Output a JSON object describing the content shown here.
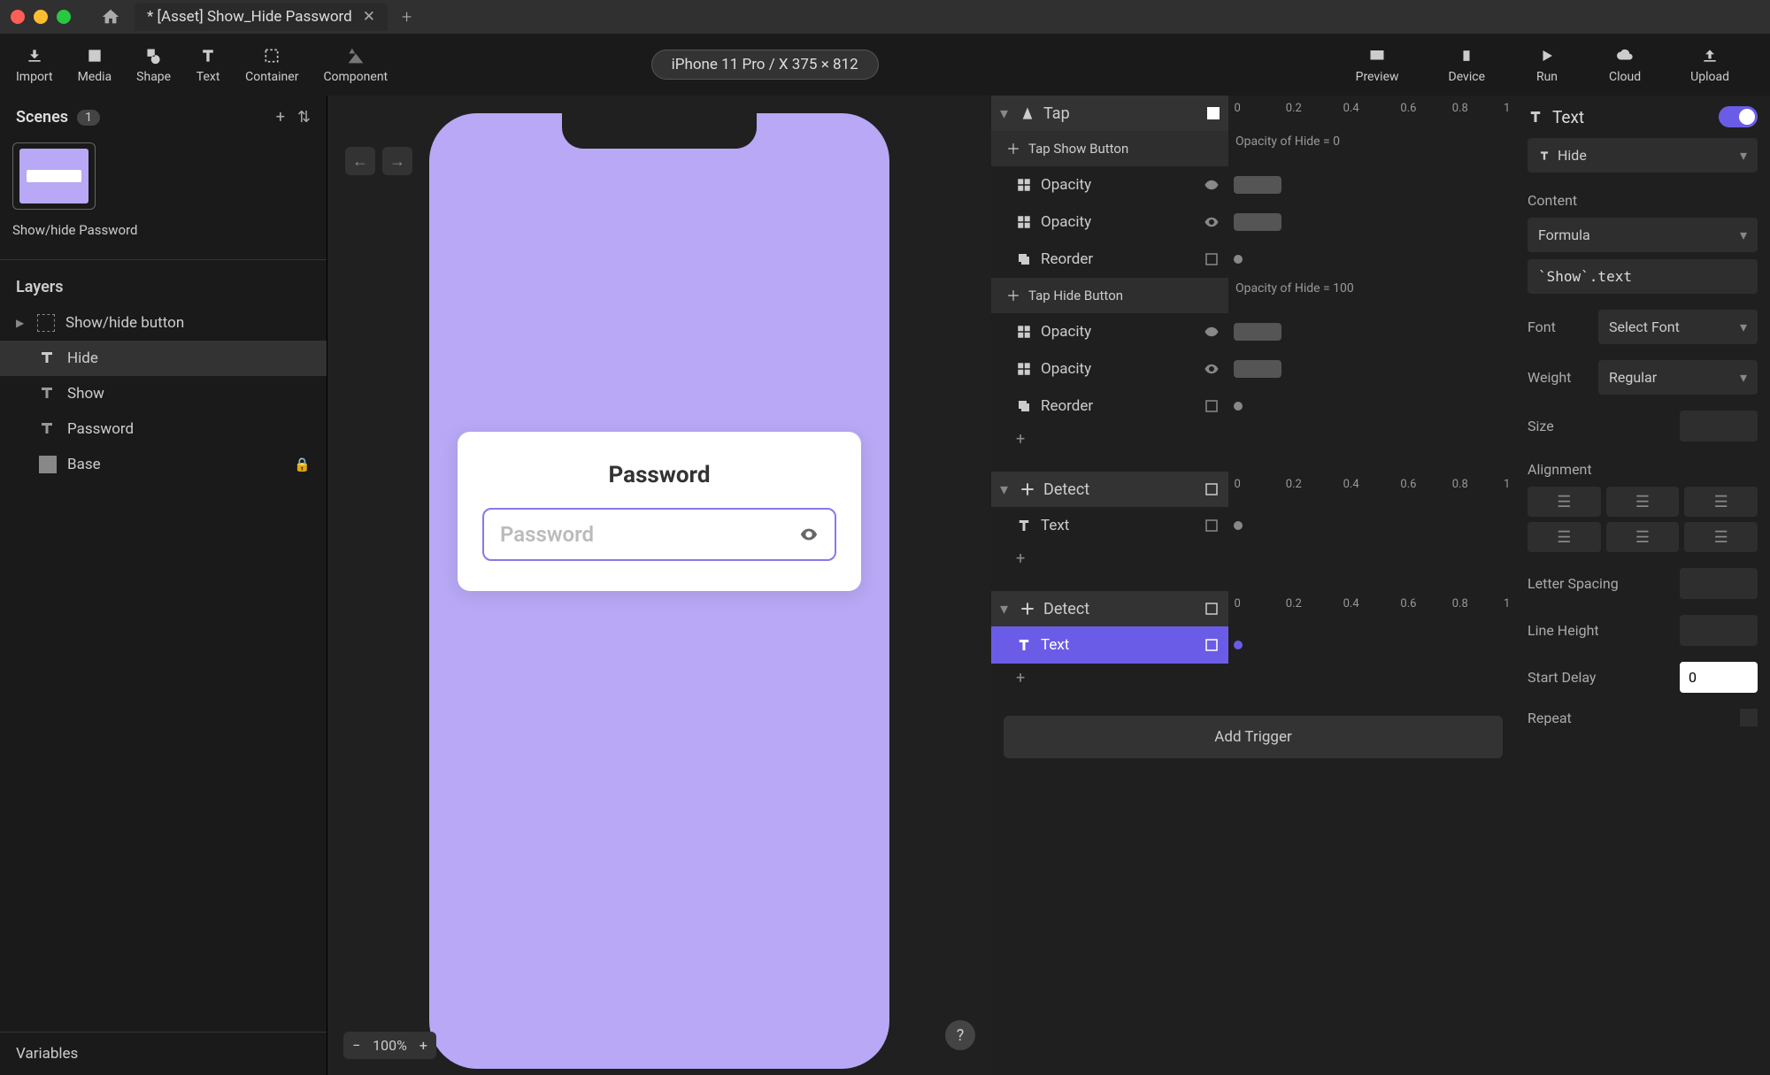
{
  "tab_title": "* [Asset] Show_Hide Password",
  "toolbar": {
    "import": "Import",
    "media": "Media",
    "shape": "Shape",
    "text": "Text",
    "container": "Container",
    "component": "Component",
    "preview": "Preview",
    "device": "Device",
    "run": "Run",
    "cloud": "Cloud",
    "upload": "Upload"
  },
  "device_label": "iPhone 11 Pro / X  375 × 812",
  "scenes": {
    "title": "Scenes",
    "count": "1",
    "scene_name": "Show/hide Password"
  },
  "layers": {
    "title": "Layers",
    "items": [
      "Show/hide button",
      "Hide",
      "Show",
      "Password",
      "Base"
    ]
  },
  "variables_title": "Variables",
  "canvas": {
    "card_title": "Password",
    "placeholder": "Password",
    "zoom": "100%"
  },
  "timeline": {
    "ruler": [
      "0",
      "0.2",
      "0.4",
      "0.6",
      "0.8",
      "1"
    ],
    "tap_label": "Tap",
    "tap_show": "Tap Show Button",
    "opacity": "Opacity",
    "reorder": "Reorder",
    "tap_hide": "Tap Hide Button",
    "note_hide0": "Opacity of Hide = 0",
    "note_hide100": "Opacity of Hide = 100",
    "detect": "Detect",
    "text": "Text",
    "add_trigger": "Add Trigger"
  },
  "inspector": {
    "title": "Text",
    "target": "Hide",
    "content_label": "Content",
    "formula": "Formula",
    "formula_value": "`Show`.text",
    "font_label": "Font",
    "font_value": "Select Font",
    "weight_label": "Weight",
    "weight_value": "Regular",
    "size_label": "Size",
    "alignment_label": "Alignment",
    "letter_spacing": "Letter Spacing",
    "line_height": "Line Height",
    "start_delay": "Start Delay",
    "start_delay_value": "0",
    "repeat": "Repeat"
  }
}
